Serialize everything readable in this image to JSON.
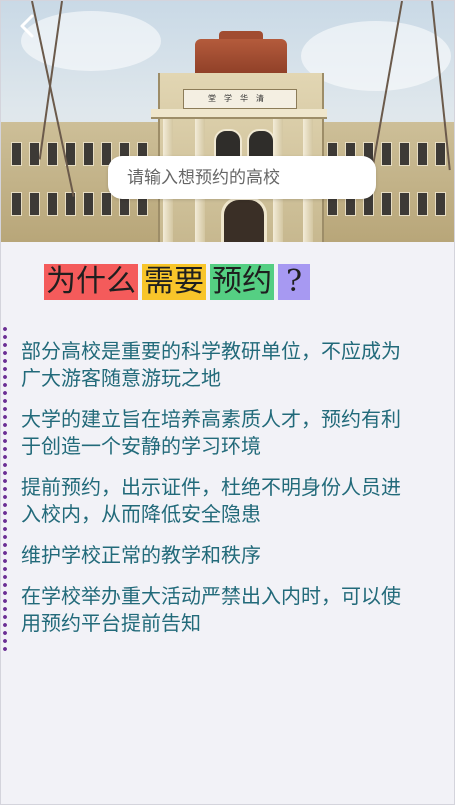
{
  "hero": {
    "signboard_text": "堂学华清",
    "back_icon": "chevron-left-icon"
  },
  "search": {
    "placeholder": "请输入想预约的高校",
    "value": ""
  },
  "title_tags": [
    {
      "text": "为什么",
      "color": "#f45b5b"
    },
    {
      "text": "需要",
      "color": "#f8c52a"
    },
    {
      "text": "预约",
      "color": "#55cf83"
    },
    {
      "text": "?",
      "color": "#a799f2"
    }
  ],
  "reasons": [
    "部分高校是重要的科学教研单位，不应成为广大游客随意游玩之地",
    "大学的建立旨在培养高素质人才，预约有利于创造一个安静的学习环境",
    "提前预约，出示证件，杜绝不明身份人员进入校内，从而降低安全隐患",
    "维护学校正常的教学和秩序",
    "在学校举办重大活动严禁出入内时，可以使用预约平台提前告知"
  ],
  "colors": {
    "background": "#f2f2f7",
    "reason_text": "#226a7a",
    "dot_rule": "#6b2f94"
  }
}
